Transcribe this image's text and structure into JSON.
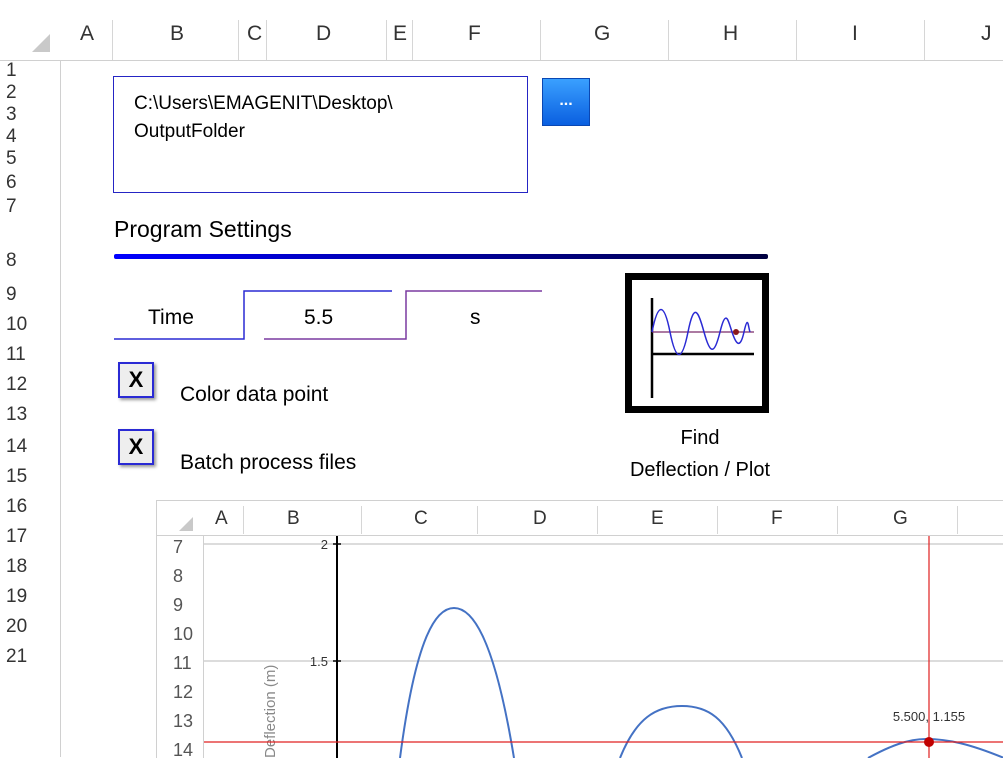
{
  "sheet": {
    "columns": [
      "A",
      "B",
      "C",
      "D",
      "E",
      "F",
      "G",
      "H",
      "I",
      "J"
    ],
    "rows": [
      "1",
      "2",
      "3",
      "4",
      "5",
      "6",
      "7",
      "8",
      "9",
      "10",
      "11",
      "12",
      "13",
      "14",
      "15",
      "16",
      "17",
      "18",
      "19",
      "20",
      "21"
    ]
  },
  "output_folder": {
    "line1": "C:\\Users\\EMAGENIT\\Desktop\\",
    "line2": "OutputFolder",
    "browse_label": "..."
  },
  "settings": {
    "heading": "Program Settings",
    "time_label": "Time",
    "time_value": "5.5",
    "time_unit": "s",
    "accent_color": "#0000ff"
  },
  "options": [
    {
      "mark": "X",
      "label": "Color data point"
    },
    {
      "mark": "X",
      "label": "Batch process files"
    }
  ],
  "action": {
    "icon": "waveform-plot-icon",
    "line1": "Find",
    "line2": "Deflection / Plot"
  },
  "embedded_sheet": {
    "columns": [
      "A",
      "B",
      "C",
      "D",
      "E",
      "F",
      "G"
    ],
    "rows": [
      "7",
      "8",
      "9",
      "10",
      "11",
      "12",
      "13",
      "14"
    ]
  },
  "chart_data": {
    "type": "line",
    "ylabel": "Deflection (m)",
    "y_ticks": [
      "2",
      "1.5"
    ],
    "ylim": [
      1.1,
      2
    ],
    "series": [
      {
        "values": [
          1.1,
          1.72,
          1.1,
          1.31,
          1.1,
          1.155,
          1.1
        ]
      }
    ],
    "point_label": "5.500, 1.155",
    "crosshair_color": "#e02020",
    "line_color": "#4472c4"
  }
}
